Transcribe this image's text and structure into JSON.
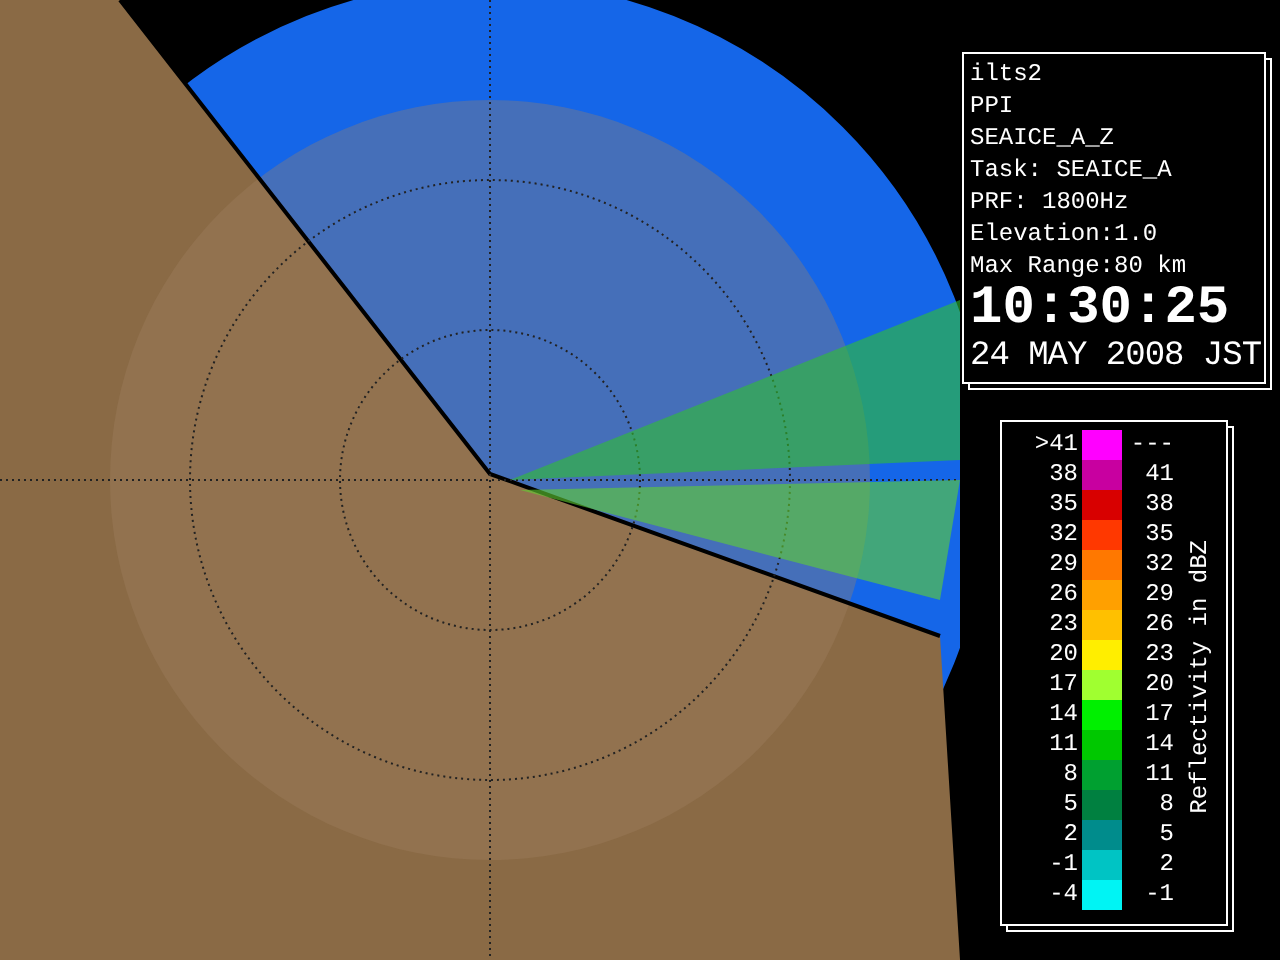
{
  "info": {
    "lines": [
      "ilts2",
      "PPI",
      "SEAICE_A_Z",
      "Task: SEAICE_A",
      "PRF: 1800Hz",
      "Elevation:1.0",
      "Max Range:80 km"
    ],
    "time": "10:30:25",
    "date": "24 MAY 2008 JST"
  },
  "legend": {
    "title": "Reflectivity in dBZ",
    "rows": [
      {
        "low": ">41",
        "high": "---",
        "color": "#ff00ff"
      },
      {
        "low": "38",
        "high": "41",
        "color": "#c800a0"
      },
      {
        "low": "35",
        "high": "38",
        "color": "#d80000"
      },
      {
        "low": "32",
        "high": "35",
        "color": "#ff3800"
      },
      {
        "low": "29",
        "high": "32",
        "color": "#ff7800"
      },
      {
        "low": "26",
        "high": "29",
        "color": "#ffa000"
      },
      {
        "low": "23",
        "high": "26",
        "color": "#ffc000"
      },
      {
        "low": "20",
        "high": "23",
        "color": "#ffee00"
      },
      {
        "low": "17",
        "high": "20",
        "color": "#a0ff30"
      },
      {
        "low": "14",
        "high": "17",
        "color": "#00f000"
      },
      {
        "low": "11",
        "high": "14",
        "color": "#00c800"
      },
      {
        "low": "8",
        "high": "11",
        "color": "#00a030"
      },
      {
        "low": "5",
        "high": "8",
        "color": "#008040"
      },
      {
        "low": "2",
        "high": "5",
        "color": "#008c8c"
      },
      {
        "low": "-1",
        "high": "2",
        "color": "#00c4c4"
      },
      {
        "low": "-4",
        "high": "-1",
        "color": "#00f4f4"
      }
    ]
  }
}
